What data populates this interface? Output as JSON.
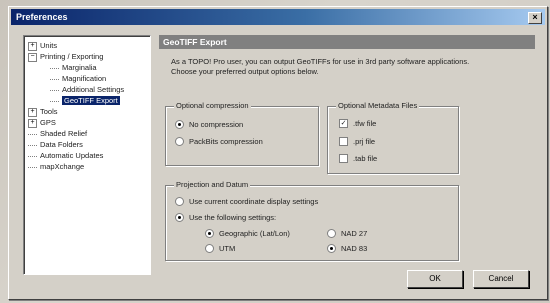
{
  "window": {
    "title": "Preferences",
    "close_label": "×"
  },
  "tree": {
    "items": [
      {
        "label": "Units",
        "expander": "+",
        "level": 1
      },
      {
        "label": "Printing / Exporting",
        "expander": "−",
        "level": 1
      },
      {
        "label": "Marginalia",
        "level": 2
      },
      {
        "label": "Magnification",
        "level": 2
      },
      {
        "label": "Additional Settings",
        "level": 2
      },
      {
        "label": "GeoTIFF Export",
        "level": 2,
        "selected": true
      },
      {
        "label": "Tools",
        "expander": "+",
        "level": 1
      },
      {
        "label": "GPS",
        "expander": "+",
        "level": 1
      },
      {
        "label": "Shaded Relief",
        "level": 1
      },
      {
        "label": "Data Folders",
        "level": 1
      },
      {
        "label": "Automatic Updates",
        "level": 1
      },
      {
        "label": "mapXchange",
        "level": 1
      }
    ]
  },
  "panel": {
    "title": "GeoTIFF Export",
    "description": "As a TOPO! Pro user, you can output GeoTIFFs for use in 3rd party software applications. Choose your preferred output options below."
  },
  "compression": {
    "title": "Optional compression",
    "options": [
      {
        "label": "No compression",
        "selected": true
      },
      {
        "label": "PackBits compression",
        "selected": false
      }
    ]
  },
  "metadata": {
    "title": "Optional Metadata Files",
    "options": [
      {
        "label": ".tfw file",
        "checked": true
      },
      {
        "label": ".prj file",
        "checked": false
      },
      {
        "label": ".tab file",
        "checked": false
      }
    ]
  },
  "projection": {
    "title": "Projection and Datum",
    "use_current": {
      "label": "Use current coordinate display settings",
      "selected": false
    },
    "use_following": {
      "label": "Use the following settings:",
      "selected": true
    },
    "geographic": {
      "label": "Geographic (Lat/Lon)",
      "selected": true
    },
    "utm": {
      "label": "UTM",
      "selected": false
    },
    "nad27": {
      "label": "NAD 27",
      "selected": false
    },
    "nad83": {
      "label": "NAD 83",
      "selected": true
    }
  },
  "buttons": {
    "ok": "OK",
    "cancel": "Cancel"
  }
}
